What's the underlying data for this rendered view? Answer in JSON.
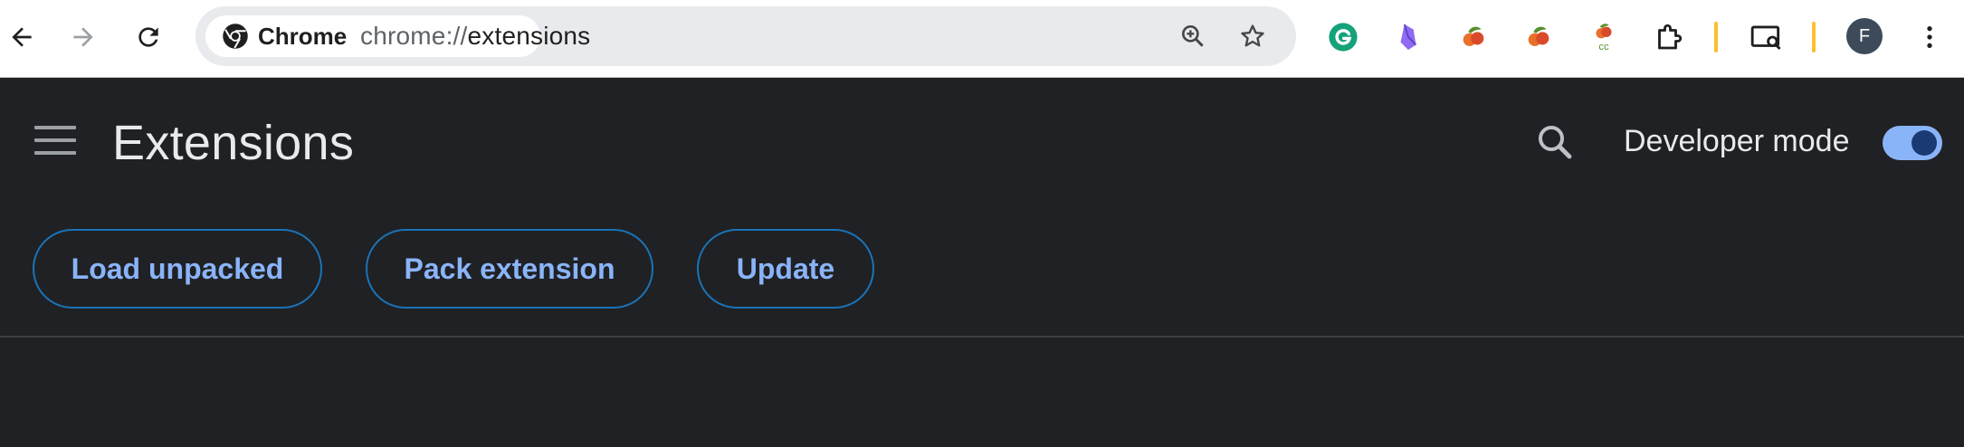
{
  "browser": {
    "chip_label": "Chrome",
    "url_scheme": "chrome://",
    "url_path": "extensions",
    "avatar_initial": "F",
    "extension_icons": [
      "grammarly-icon",
      "crystal-icon",
      "fruit-icon",
      "fruit-icon-2",
      "fruit-cc-icon",
      "puzzle-piece-icon",
      "screen-search-icon"
    ],
    "cc_label": "cc"
  },
  "page": {
    "title": "Extensions",
    "developer_mode_label": "Developer mode",
    "developer_mode_on": true,
    "buttons": {
      "load_unpacked": "Load unpacked",
      "pack_extension": "Pack extension",
      "update": "Update"
    }
  },
  "colors": {
    "background": "#202124",
    "accent": "#8ab4f8",
    "button_border": "#1a73b8",
    "toggle_knob": "#1a3a73"
  }
}
